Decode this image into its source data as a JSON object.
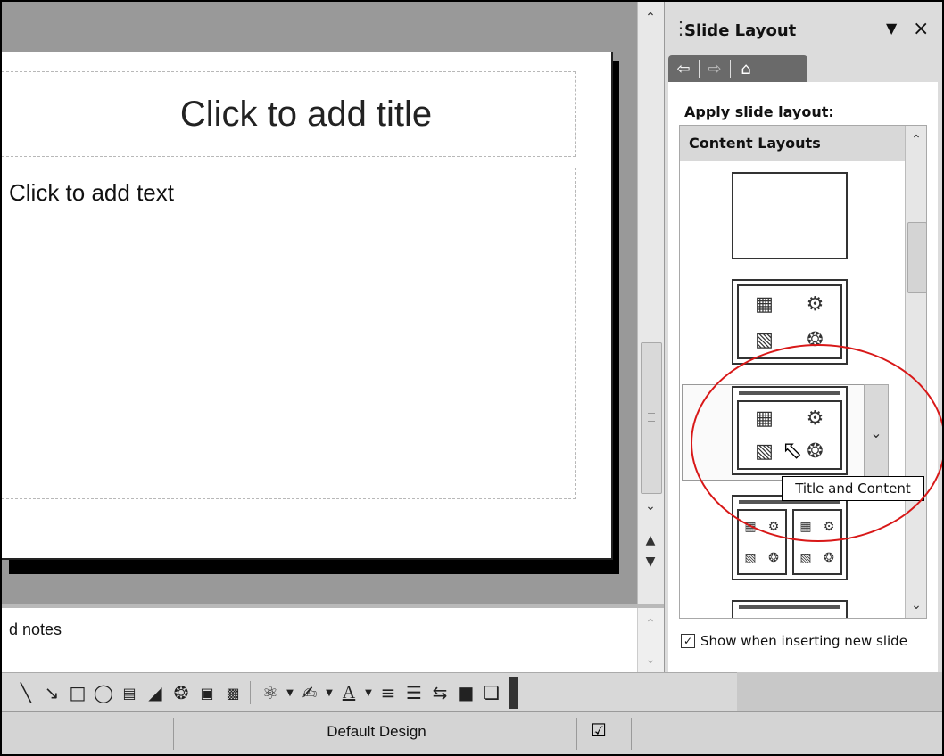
{
  "slide": {
    "title_placeholder": "Click to add title",
    "body_placeholder": "Click to add text"
  },
  "notes": {
    "text": "d notes"
  },
  "task_pane": {
    "title": "Slide Layout",
    "dropdown_icon": "dropdown-arrow-icon",
    "close_icon": "close-icon",
    "nav": [
      "back-icon",
      "forward-icon",
      "home-icon"
    ],
    "apply_label": "Apply slide layout:",
    "section_header": "Content Layouts",
    "layouts": [
      "Blank",
      "Content",
      "Title and Content",
      "Title and 4 Content"
    ],
    "tooltip": "Title and Content",
    "show_checkbox_checked": true,
    "show_label": "Show when inserting new slide"
  },
  "drawing_toolbar": {
    "tools": [
      "line-icon",
      "arrow-icon",
      "rectangle-icon",
      "oval-icon",
      "text-box-icon",
      "wordart-icon",
      "diagram-icon",
      "clip-art-icon",
      "picture-icon",
      "fill-color-icon",
      "line-color-icon",
      "font-color-icon",
      "line-style-icon",
      "dash-style-icon",
      "arrow-style-icon",
      "shadow-style-icon",
      "3d-style-icon"
    ]
  },
  "status_bar": {
    "design_name": "Default Design"
  },
  "colors": {
    "workspace_bg": "#999999",
    "highlight_circle": "#d81818",
    "task_nav_bg": "#6a6a6a"
  }
}
